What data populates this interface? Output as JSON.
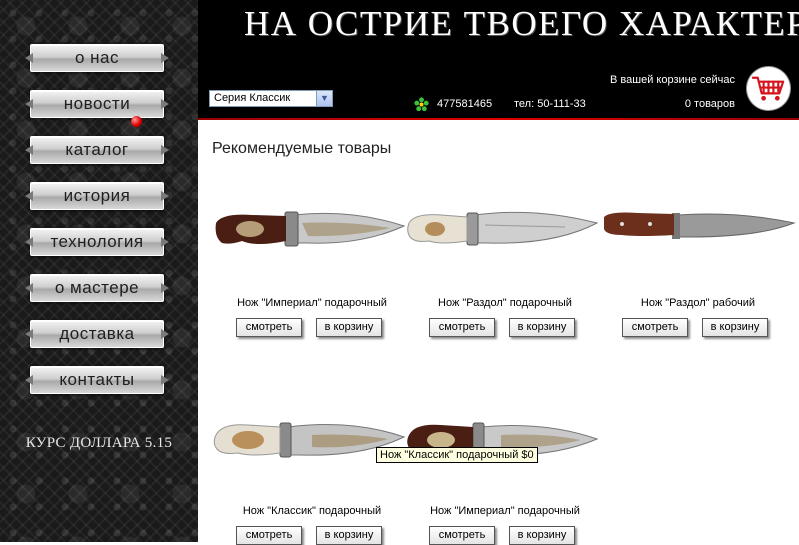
{
  "sidebar": {
    "menu": [
      {
        "label": "о нас"
      },
      {
        "label": "новости"
      },
      {
        "label": "каталог"
      },
      {
        "label": "история"
      },
      {
        "label": "технология"
      },
      {
        "label": "о мастере"
      },
      {
        "label": "доставка"
      },
      {
        "label": "контакты"
      }
    ],
    "rate": "КУРС ДОЛЛАРА 5.15"
  },
  "header": {
    "slogan": "НА ОСТРИЕ ТВОЕГО ХАРАКТЕРА",
    "series_select": "Серия Классик",
    "icq": "477581465",
    "phone": "тел: 50-111-33",
    "cart_line1": "В вашей корзине сейчас",
    "cart_line2": "0 товаров",
    "icons": {
      "icq": "icq-flower-icon",
      "cart": "shopping-cart-icon",
      "dropdown": "chevron-down-icon"
    }
  },
  "content": {
    "title": "Рекомендуемые товары",
    "view_label": "смотреть",
    "cart_label": "в корзину",
    "products": [
      {
        "name": "Нож \"Империал\" подарочный"
      },
      {
        "name": "Нож \"Раздол\" подарочный"
      },
      {
        "name": "Нож \"Раздол\" рабочий"
      },
      {
        "name": "Нож \"Классик\" подарочный"
      },
      {
        "name": "Нож \"Империал\" подарочный"
      }
    ],
    "tooltip": "Нож \"Классик\" подарочный $0"
  },
  "colors": {
    "accent_red": "#e00000",
    "header_bg": "#000000"
  }
}
